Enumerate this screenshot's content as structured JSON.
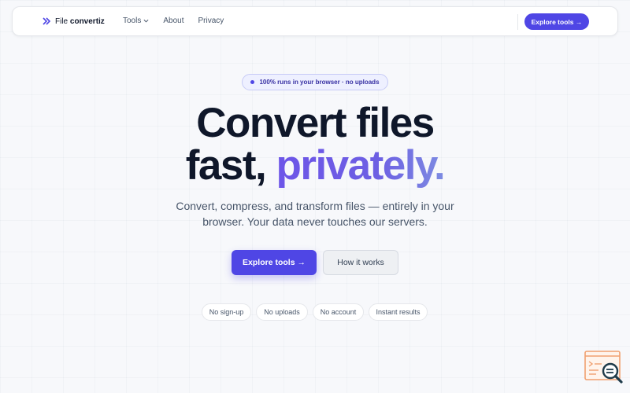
{
  "nav": {
    "logo_plain": "File ",
    "logo_bold": "convertiz",
    "links": [
      {
        "label": "Tools",
        "has_dropdown": true
      },
      {
        "label": "About"
      },
      {
        "label": "Privacy"
      }
    ],
    "cta_label": "Explore tools →"
  },
  "badge": {
    "label": "100% runs in your browser · no uploads"
  },
  "hero": {
    "line1": "Convert files",
    "line2_plain": "fast, ",
    "line2_accent": "privately.",
    "subtitle": "Convert, compress, and transform files — entirely in your browser. Your data never touches our servers.",
    "primary_cta": "Explore tools →",
    "secondary_cta": "How it works"
  },
  "features": [
    "No sign-up",
    "No uploads",
    "No account",
    "Instant results"
  ],
  "colors": {
    "accent": "#4f46e5",
    "text": "#0f172a",
    "muted": "#475569",
    "background": "#f7f8fb"
  },
  "icons": {
    "logo": "double-chevron-icon",
    "dropdown": "chevron-down-icon",
    "corner": "search-document-icon"
  }
}
